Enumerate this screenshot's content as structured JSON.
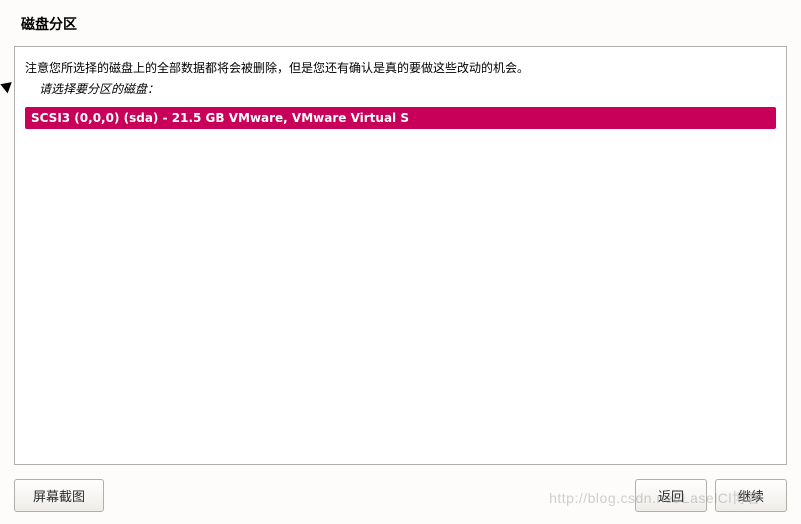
{
  "header": {
    "title": "磁盘分区"
  },
  "panel": {
    "instruction": "注意您所选择的磁盘上的全部数据都将会被删除，但是您还有确认是真的要做这些改动的机会。",
    "sub_instruction": "请选择要分区的磁盘：",
    "disks": [
      {
        "label": "SCSI3 (0,0,0) (sda) - 21.5 GB VMware, VMware Virtual S"
      }
    ]
  },
  "footer": {
    "screenshot_label": "屏幕截图",
    "back_label": "返回",
    "continue_label": "继续"
  },
  "watermark": "http://blog.csdn.net/LaselCl博客"
}
